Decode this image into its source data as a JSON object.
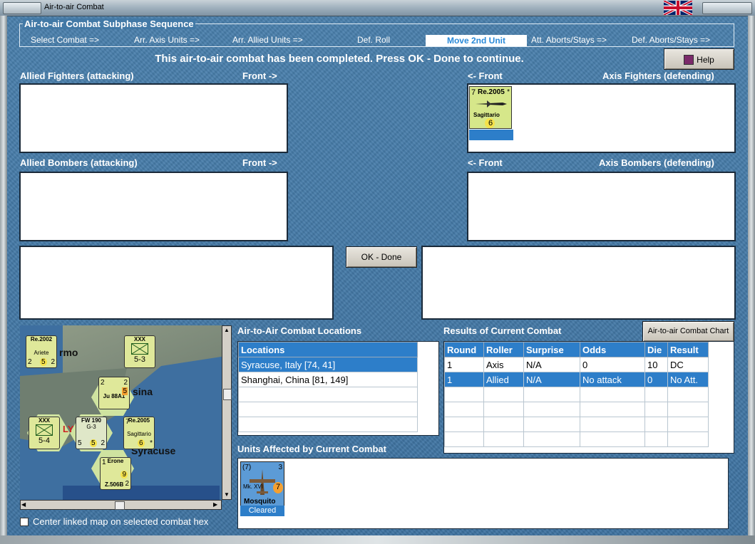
{
  "window": {
    "title": "Air-to-air Combat"
  },
  "sequence": {
    "title": "Air-to-air Combat Subphase Sequence",
    "steps": [
      "Select Combat =>",
      "Arr. Axis Units =>",
      "Arr. Allied Units =>",
      "Def. Roll",
      "Move 2nd Unit",
      "Att. Aborts/Stays =>",
      "Def. Aborts/Stays =>"
    ],
    "active": "Move 2nd Unit"
  },
  "message": "This air-to-air combat has been completed.  Press OK - Done to continue.",
  "help_label": "Help",
  "panels": {
    "allied_fighters": "Allied Fighters (attacking)",
    "allied_fighters_front": "Front ->",
    "axis_fighters_front": "<- Front",
    "axis_fighters": "Axis Fighters (defending)",
    "allied_bombers": "Allied Bombers (attacking)",
    "allied_bombers_front": "Front ->",
    "axis_bombers_front": "<- Front",
    "axis_bombers": "Axis Bombers (defending)"
  },
  "axis_fighter_unit": {
    "top_left": "7",
    "name": "Re.2005",
    "star": "*",
    "sub": "Sagittario",
    "bottom": "6"
  },
  "ok_done_label": "OK - Done",
  "locations": {
    "title": "Air-to-Air Combat Locations",
    "header": "Locations",
    "rows": [
      "Syracuse, Italy [74, 41]",
      "Shanghai, China [81, 149]"
    ]
  },
  "results": {
    "title": "Results of Current Combat",
    "chart_button": "Air-to-air Combat Chart",
    "headers": [
      "Round",
      "Roller",
      "Surprise",
      "Odds",
      "Die",
      "Result"
    ],
    "rows": [
      [
        "1",
        "Axis",
        "N/A",
        "0",
        "10",
        "DC"
      ],
      [
        "1",
        "Allied",
        "N/A",
        "No attack",
        "0",
        "No Att."
      ]
    ]
  },
  "affected": {
    "title": "Units Affected by Current Combat",
    "unit_name": "Mosquito",
    "unit_mark": "Mk. XVI",
    "unit_left": "(7)",
    "unit_right": "3",
    "unit_value": "7",
    "status": "Cleared"
  },
  "map": {
    "labels": [
      "rmo",
      "sina",
      "Syracuse",
      "LY"
    ],
    "counters": [
      {
        "top": "Re.2002",
        "sub": "Ariete",
        "l": "2",
        "m": "5",
        "r": "2"
      },
      {
        "top": "XXX",
        "sub": "",
        "l": "",
        "m": "5-3",
        "r": ""
      },
      {
        "top": "Ju 88A1",
        "sub": "",
        "l": "2",
        "m": "5",
        "r": "2"
      },
      {
        "top": "Re.2005",
        "sub": "Sagittario",
        "l": "7",
        "m": "6",
        "r": "*"
      },
      {
        "top": "XXX",
        "sub": "",
        "l": "",
        "m": "5-4",
        "r": ""
      },
      {
        "top": "FW 190",
        "sub": "G-3",
        "l": "5",
        "m": "5",
        "r": "2"
      },
      {
        "top": "Z.506B",
        "sub": "Erone",
        "l": "1",
        "m": "9",
        "r": "2"
      }
    ]
  },
  "center_checkbox_label": "Center linked map on selected combat hex",
  "colors": {
    "accent": "#2d7ec9",
    "background": "#3f77a4"
  }
}
